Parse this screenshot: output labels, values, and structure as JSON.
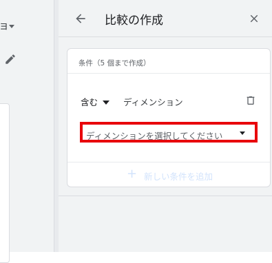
{
  "left_pane": {
    "toolbar_fragment": "ョ"
  },
  "panel": {
    "title": "比較の作成",
    "card": {
      "title": "条件（5 個まで作成）",
      "condition": {
        "include_label": "含む",
        "dimension_label": "ディメンション",
        "select_placeholder": "ディメンションを選択してください"
      },
      "add_condition_label": "新しい条件を追加"
    }
  },
  "colors": {
    "highlight_border": "#e8000b",
    "disabled_add": "#d2e3fc",
    "panel_bg": "#f1f3f4"
  },
  "icons": {
    "back": "arrow-back-icon",
    "close": "close-icon",
    "delete": "trash-icon",
    "edit": "pencil-icon",
    "add": "plus-icon"
  }
}
